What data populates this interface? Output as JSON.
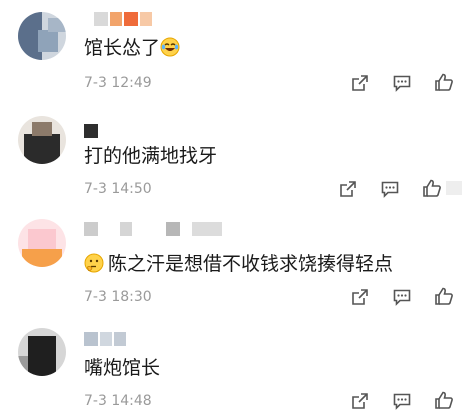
{
  "comments": [
    {
      "text": "馆长怂了",
      "emoji": "laughing-crying-face",
      "time": "7-3 12:49"
    },
    {
      "text": "打的他满地找牙",
      "time": "7-3 14:50"
    },
    {
      "text": "陈之汗是想借不收钱求饶揍得轻点",
      "emoji": "thinking-face",
      "time": "7-3 18:30"
    },
    {
      "text": "嘴炮馆长",
      "time": "7-3 14:48"
    }
  ]
}
